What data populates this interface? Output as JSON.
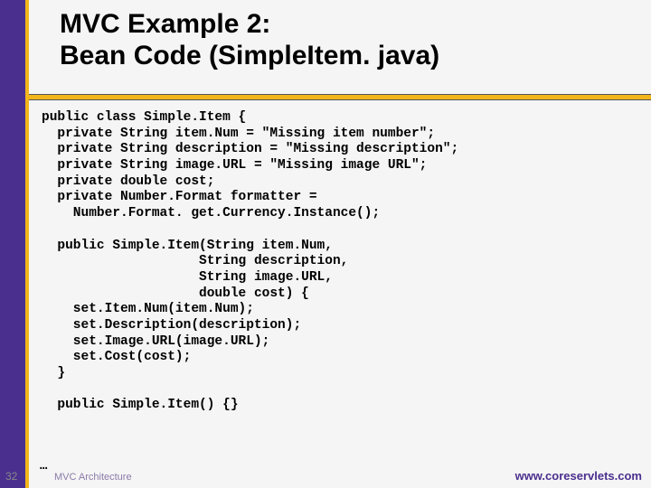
{
  "title": {
    "line1": "MVC Example 2:",
    "line2": "Bean Code (SimpleItem. java)"
  },
  "code_lines": [
    "public class Simple.Item {",
    "  private String item.Num = \"Missing item number\";",
    "  private String description = \"Missing description\";",
    "  private String image.URL = \"Missing image URL\";",
    "  private double cost;",
    "  private Number.Format formatter =",
    "    Number.Format. get.Currency.Instance();",
    "",
    "  public Simple.Item(String item.Num,",
    "                    String description,",
    "                    String image.URL,",
    "                    double cost) {",
    "    set.Item.Num(item.Num);",
    "    set.Description(description);",
    "    set.Image.URL(image.URL);",
    "    set.Cost(cost);",
    "  }",
    "",
    "  public Simple.Item() {}"
  ],
  "ellipsis": "…",
  "footer": {
    "page_number": "32",
    "left_label": "MVC Architecture",
    "right_url": "www.coreservlets.com"
  }
}
